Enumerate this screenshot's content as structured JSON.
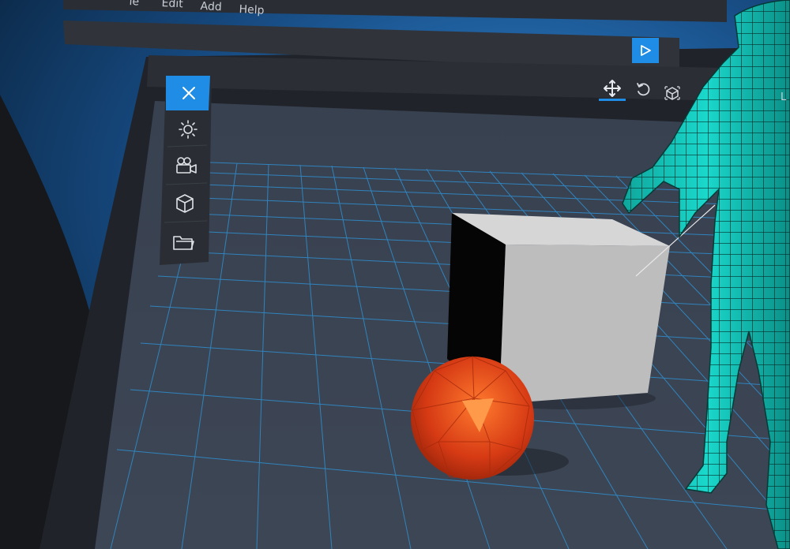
{
  "menu": {
    "items": [
      {
        "label": "File",
        "visible_text": "le"
      },
      {
        "label": "Edit"
      },
      {
        "label": "Add"
      },
      {
        "label": "Help"
      }
    ]
  },
  "toolbar": {
    "play": {
      "icon": "play-icon"
    }
  },
  "transform_tools": [
    {
      "name": "move",
      "icon": "move-arrows-icon",
      "active": true
    },
    {
      "name": "rotate",
      "icon": "rotate-icon",
      "active": false
    },
    {
      "name": "scale",
      "icon": "scale-cube-icon",
      "active": false
    }
  ],
  "side_tools": [
    {
      "name": "close",
      "icon": "close-icon",
      "active": true
    },
    {
      "name": "light",
      "icon": "sun-icon"
    },
    {
      "name": "camera",
      "icon": "camera-icon"
    },
    {
      "name": "object",
      "icon": "cube-icon"
    },
    {
      "name": "folder",
      "icon": "folder-icon"
    }
  ],
  "truncated_label": "L",
  "colors": {
    "accent": "#1f8ce6",
    "panel": "#2b2f34",
    "grid_line": "#2f8fd0",
    "floor": "#3a4350",
    "sphere": "#e0441a",
    "figure": "#14c8bd",
    "cube_face": "#c8c8c8"
  }
}
